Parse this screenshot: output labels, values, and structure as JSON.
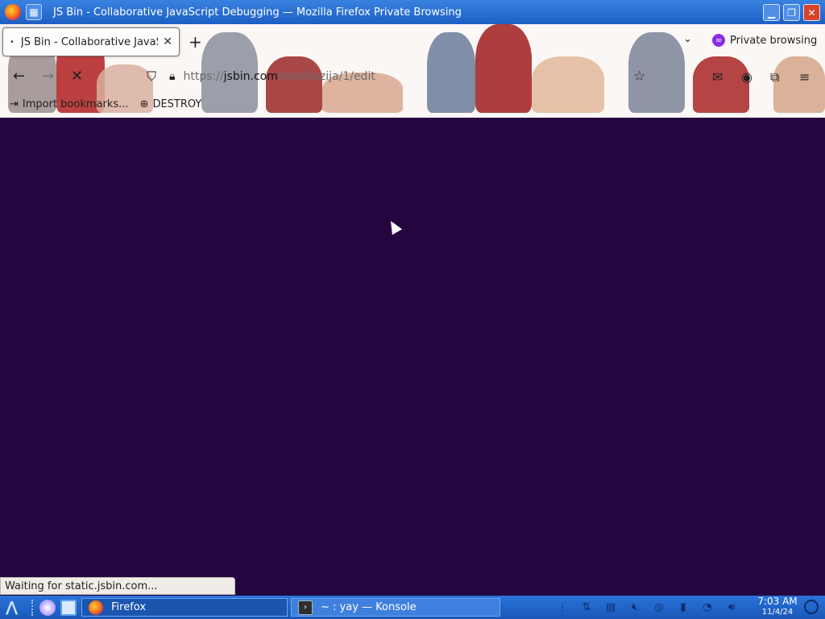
{
  "window": {
    "title": "JS Bin - Collaborative JavaScript Debugging — Mozilla Firefox Private Browsing"
  },
  "tab": {
    "title": "JS Bin - Collaborative JavaScript Debugging",
    "loading_indicator": "•"
  },
  "private": {
    "label": "Private browsing"
  },
  "url": {
    "scheme": "https://",
    "host": "jsbin.com",
    "path": "/holohozija/1/edit"
  },
  "bookmarks": {
    "items": [
      {
        "label": "Import bookmarks...",
        "icon": "import-icon"
      },
      {
        "label": "DESTROY",
        "icon": "globe-icon"
      }
    ]
  },
  "status": {
    "text": "Waiting for static.jsbin.com..."
  },
  "page": {
    "background": "#240540"
  },
  "taskbar": {
    "tasks": [
      {
        "label": "Firefox"
      },
      {
        "label": "~ : yay — Konsole"
      }
    ],
    "clock": {
      "time": "7:03 AM",
      "date": "11/4/24"
    }
  }
}
